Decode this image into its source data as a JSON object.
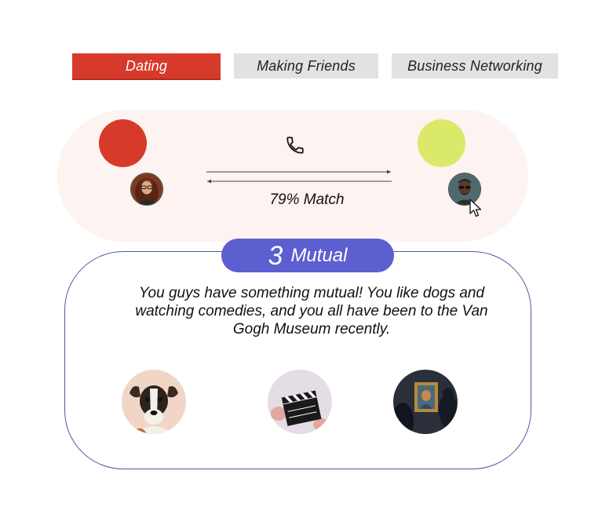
{
  "tabs": [
    {
      "label": "Dating",
      "active": true
    },
    {
      "label": "Making Friends",
      "active": false
    },
    {
      "label": "Business Networking",
      "active": false
    }
  ],
  "match": {
    "percent_label": "79% Match",
    "percent": 79,
    "user_color": "#d63a2a",
    "match_color": "#dbe96a",
    "icons": {
      "call": "phone-icon",
      "connection": "exchange-arrows-icon",
      "pointer": "cursor-icon"
    }
  },
  "mutual": {
    "count": "3",
    "label": "Mutual",
    "description": "You guys have something mutual! You like dogs and watching comedies, and you all have been to the Van Gogh Museum recently.",
    "interests": [
      "dog",
      "clapperboard",
      "museum-painting"
    ]
  },
  "colors": {
    "accent": "#d63a2a",
    "inactive_tab": "#e2e2e2",
    "panel_bg": "#fdf3f0",
    "mutual_pill": "#5b5fd0",
    "card_border": "#4a5aa0"
  }
}
